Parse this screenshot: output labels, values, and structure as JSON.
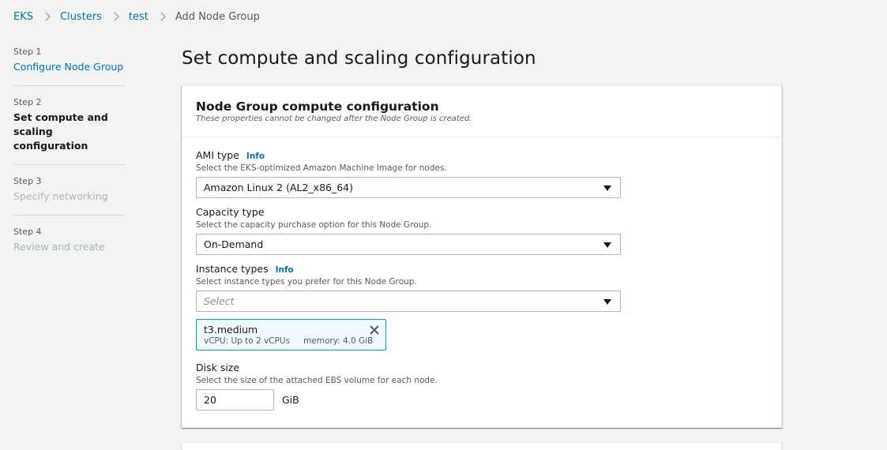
{
  "breadcrumb": {
    "items": [
      "EKS",
      "Clusters",
      "test"
    ],
    "current": "Add Node Group"
  },
  "steps": [
    {
      "num": "Step 1",
      "title": "Configure Node Group",
      "state": "link"
    },
    {
      "num": "Step 2",
      "title": "Set compute and scaling configuration",
      "state": "active"
    },
    {
      "num": "Step 3",
      "title": "Specify networking",
      "state": "disabled"
    },
    {
      "num": "Step 4",
      "title": "Review and create",
      "state": "disabled"
    }
  ],
  "page": {
    "title": "Set compute and scaling configuration"
  },
  "panel": {
    "title": "Node Group compute configuration",
    "description": "These properties cannot be changed after the Node Group is created."
  },
  "ami": {
    "label": "AMI type",
    "info": "Info",
    "description": "Select the EKS-optimized Amazon Machine Image for nodes.",
    "value": "Amazon Linux 2 (AL2_x86_64)"
  },
  "capacity": {
    "label": "Capacity type",
    "description": "Select the capacity purchase option for this Node Group.",
    "value": "On-Demand"
  },
  "instance": {
    "label": "Instance types",
    "info": "Info",
    "description": "Select instance types you prefer for this Node Group.",
    "placeholder": "Select",
    "token": {
      "name": "t3.medium",
      "vcpu": "vCPU: Up to 2 vCPUs",
      "memory": "memory: 4.0 GiB"
    }
  },
  "disk": {
    "label": "Disk size",
    "description": "Select the size of the attached EBS volume for each node.",
    "value": "20",
    "unit": "GiB"
  },
  "colors": {
    "link": "#0073bb",
    "token_border": "#00a1c9",
    "token_bg": "#f1faff",
    "background": "#f2f3f3"
  }
}
